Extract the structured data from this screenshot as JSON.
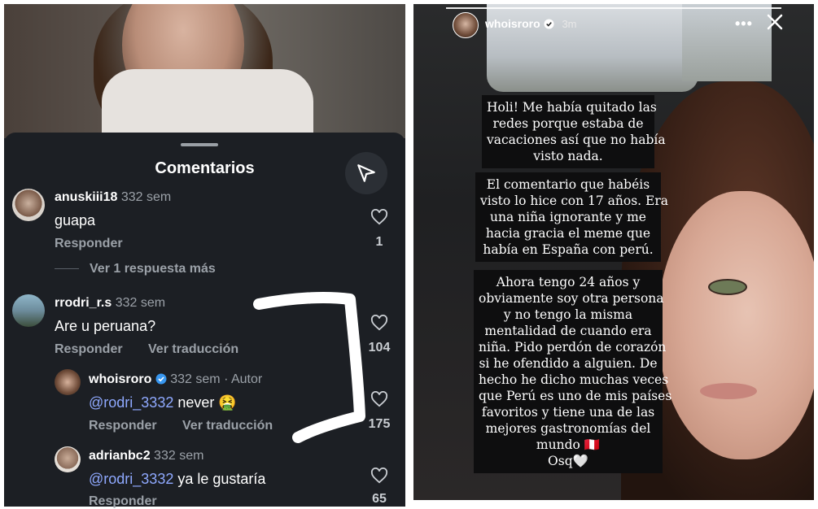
{
  "comments_panel": {
    "title": "Comentarios",
    "comments": [
      {
        "username": "anuskiii18",
        "time": "332 sem",
        "text": "guapa",
        "reply": "Responder",
        "likes": "1",
        "more_replies": "Ver 1 respuesta más"
      },
      {
        "username": "rrodri_r.s",
        "time": "332 sem",
        "text": "Are u peruana?",
        "reply": "Responder",
        "translate": "Ver traducción",
        "likes": "104"
      },
      {
        "username": "whoisroro",
        "time": "332 sem · Autor",
        "mention": "@rodri_3332",
        "text": " never",
        "emoji": "🤮",
        "reply": "Responder",
        "translate": "Ver traducción",
        "likes": "175"
      },
      {
        "username": "adrianbc2",
        "time": "332 sem",
        "mention": "@rodri_3332",
        "text": " ya le gustaría",
        "reply": "Responder",
        "likes": "65"
      }
    ]
  },
  "story": {
    "username": "whoisroro",
    "time": "3m",
    "more": "•••",
    "text_blocks": [
      [
        "Holi! Me había quitado las",
        "redes porque estaba de",
        "vacaciones así que no había",
        "visto nada."
      ],
      [
        "El comentario que habéis",
        "visto lo hice con 17 años. Era",
        "una niña ignorante y me",
        "hacia gracia el meme que",
        "había en España con perú."
      ],
      [
        "Ahora tengo 24 años y",
        "obviamente soy otra persona",
        "y no tengo la misma",
        "mentalidad de cuando era",
        "niña. Pido perdón de corazón",
        "si he ofendido a alguien. De",
        "hecho he dicho muchas veces",
        "que Perú es uno de mis países",
        "favoritos y tiene una de las",
        "mejores gastronomías del",
        "mundo 🇵🇪",
        "Osq🤍"
      ]
    ]
  },
  "colors": {
    "accent_link": "#8fa9ff",
    "verified": "#3897f0",
    "panel_bg": "#1c1f24"
  }
}
